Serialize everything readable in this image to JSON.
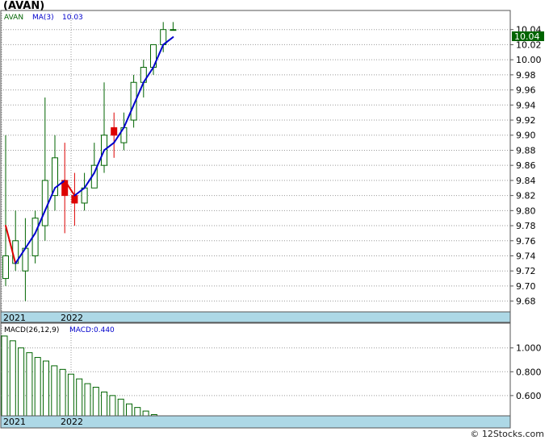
{
  "title": "(AVAN)",
  "footer": "© 12Stocks.com",
  "chart_data": [
    {
      "type": "candlestick",
      "legend": {
        "symbol": "AVAN",
        "ma_label": "MA(3)",
        "ma_value": "10.03"
      },
      "last_price_label": "10.04",
      "ylim": [
        9.67,
        10.06
      ],
      "yticks": [
        "10.04",
        "10.02",
        "10.00",
        "9.98",
        "9.96",
        "9.94",
        "9.92",
        "9.90",
        "9.88",
        "9.86",
        "9.84",
        "9.82",
        "9.80",
        "9.78",
        "9.76",
        "9.74",
        "9.72",
        "9.70",
        "9.68"
      ],
      "xticks": [
        "2021",
        "2022"
      ],
      "candles": [
        {
          "o": 9.71,
          "h": 9.9,
          "l": 9.7,
          "c": 9.74
        },
        {
          "o": 9.73,
          "h": 9.8,
          "l": 9.72,
          "c": 9.76
        },
        {
          "o": 9.72,
          "h": 9.79,
          "l": 9.68,
          "c": 9.75
        },
        {
          "o": 9.74,
          "h": 9.8,
          "l": 9.73,
          "c": 9.79
        },
        {
          "o": 9.78,
          "h": 9.95,
          "l": 9.76,
          "c": 9.84
        },
        {
          "o": 9.82,
          "h": 9.9,
          "l": 9.8,
          "c": 9.87
        },
        {
          "o": 9.84,
          "h": 9.89,
          "l": 9.77,
          "c": 9.82
        },
        {
          "o": 9.82,
          "h": 9.85,
          "l": 9.78,
          "c": 9.81
        },
        {
          "o": 9.81,
          "h": 9.85,
          "l": 9.8,
          "c": 9.83
        },
        {
          "o": 9.83,
          "h": 9.89,
          "l": 9.83,
          "c": 9.86
        },
        {
          "o": 9.86,
          "h": 9.97,
          "l": 9.85,
          "c": 9.9
        },
        {
          "o": 9.91,
          "h": 9.93,
          "l": 9.87,
          "c": 9.9
        },
        {
          "o": 9.89,
          "h": 9.93,
          "l": 9.88,
          "c": 9.91
        },
        {
          "o": 9.92,
          "h": 9.98,
          "l": 9.91,
          "c": 9.97
        },
        {
          "o": 9.97,
          "h": 10.0,
          "l": 9.95,
          "c": 9.99
        },
        {
          "o": 9.99,
          "h": 10.02,
          "l": 9.98,
          "c": 10.02
        },
        {
          "o": 10.02,
          "h": 10.05,
          "l": 10.01,
          "c": 10.04
        },
        {
          "o": 10.04,
          "h": 10.05,
          "l": 10.04,
          "c": 10.04
        }
      ],
      "ma": [
        9.78,
        9.73,
        9.75,
        9.77,
        9.8,
        9.83,
        9.84,
        9.82,
        9.83,
        9.85,
        9.88,
        9.89,
        9.91,
        9.94,
        9.97,
        9.99,
        10.02,
        10.03
      ],
      "colors": {
        "up_fill": "#ffffff",
        "up_stroke": "#006400",
        "down": "#dd0000",
        "ma_up": "#0000cc",
        "ma_down": "#dd0000",
        "axis_band": "#add8e6"
      }
    },
    {
      "type": "bar",
      "legend": {
        "label": "MACD(26,12,9)",
        "value_label": "MACD:0.440"
      },
      "ylim": [
        0.43,
        1.12
      ],
      "yticks": [
        "1.000",
        "0.800",
        "0.600"
      ],
      "xticks": [
        "2021",
        "2022"
      ],
      "values": [
        1.1,
        1.06,
        1.0,
        0.96,
        0.92,
        0.89,
        0.85,
        0.82,
        0.78,
        0.74,
        0.7,
        0.67,
        0.63,
        0.6,
        0.57,
        0.53,
        0.5,
        0.47,
        0.44
      ],
      "colors": {
        "bar_stroke": "#006400"
      }
    }
  ]
}
